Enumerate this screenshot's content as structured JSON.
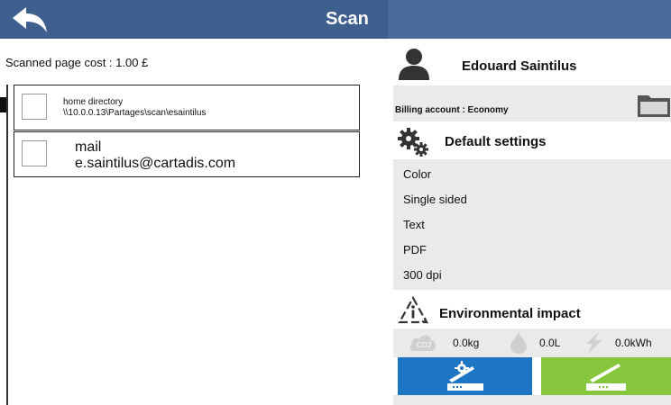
{
  "header": {
    "title": "Scan",
    "back_icon": "back-arrow-icon",
    "colors": {
      "bar": "#3f5f8f",
      "right_panel": "#4a6a9a"
    }
  },
  "left": {
    "cost_text": "Scanned page cost : 1.00 £",
    "destinations": [
      {
        "name": "home directory",
        "detail": "\\\\10.0.0.13\\Partages\\scan\\esaintilus"
      },
      {
        "name": "mail",
        "detail": "e.saintilus@cartadis.com"
      }
    ]
  },
  "user": {
    "name": "Edouard Saintilus",
    "icon": "user-icon"
  },
  "billing": {
    "label": "Billing account : Economy",
    "icon": "folder-icon"
  },
  "defaults": {
    "title": "Default settings",
    "icon": "gears-icon",
    "items": [
      "Color",
      "Single sided",
      "Text",
      "PDF",
      "300 dpi"
    ]
  },
  "environment": {
    "title": "Environmental impact",
    "icon": "recycle-info-icon",
    "co2": "0.0kg",
    "water": "0.0L",
    "energy": "0.0kWh",
    "co2_icon": "co2-cloud-icon",
    "water_icon": "water-drop-icon",
    "energy_icon": "lightning-icon"
  },
  "actions": {
    "scan_settings_icon": "scanner-settings-icon",
    "scan_icon": "scanner-icon",
    "colors": {
      "scan_settings": "#1d75c4",
      "scan": "#86c63d"
    }
  }
}
